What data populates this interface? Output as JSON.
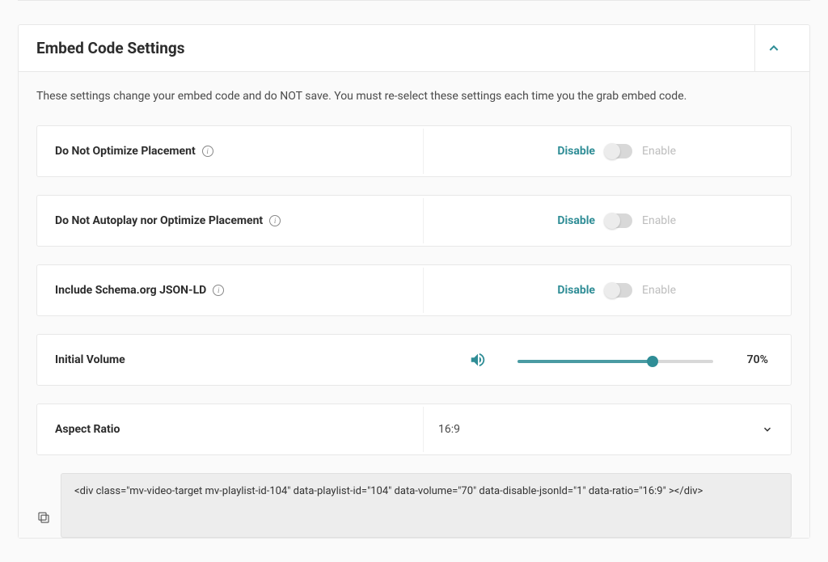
{
  "panel": {
    "title": "Embed Code Settings",
    "description": "These settings change your embed code and do NOT save. You must re-select these settings each time you the grab embed code."
  },
  "settings": {
    "optimize": {
      "label": "Do Not Optimize Placement",
      "disable": "Disable",
      "enable": "Enable"
    },
    "autoplay": {
      "label": "Do Not Autoplay nor Optimize Placement",
      "disable": "Disable",
      "enable": "Enable"
    },
    "schema": {
      "label": "Include Schema.org JSON-LD",
      "disable": "Disable",
      "enable": "Enable"
    },
    "volume": {
      "label": "Initial Volume",
      "value_display": "70%"
    },
    "ratio": {
      "label": "Aspect Ratio",
      "value": "16:9"
    }
  },
  "code": {
    "text": "<div class=\"mv-video-target mv-playlist-id-104\" data-playlist-id=\"104\"  data-volume=\"70\" data-disable-jsonld=\"1\" data-ratio=\"16:9\" ></div>"
  }
}
